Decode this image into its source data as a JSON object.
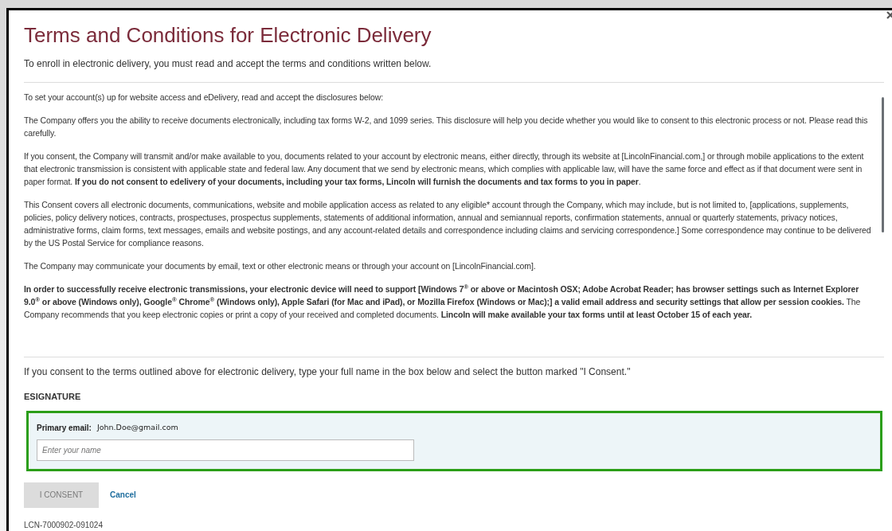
{
  "dialog": {
    "title": "Terms and Conditions for Electronic Delivery",
    "subtitle": "To enroll in electronic delivery, you must read and accept the terms and conditions written below."
  },
  "disclosure": {
    "paragraphs": [
      "To set your account(s) up for website access and eDelivery, read and accept the disclosures below:",
      "The Company offers you the ability to receive documents electronically, including tax forms W-2, and 1099 series. This disclosure will help you decide whether you would like to consent to this electronic process or not. Please read this carefully.",
      "If you consent, the Company will transmit and/or make available to you, documents related to your account by electronic means, either directly, through its website at [LincolnFinancial.com,] or through mobile applications to the extent that electronic transmission is consistent with applicable state and federal law. Any document that we send by electronic means, which complies with applicable law, will have the same force and effect as if that document were sent in paper format. **If you do not consent to edelivery of your documents, including your tax forms, Lincoln will furnish the documents and tax forms to you in paper**.",
      "This Consent covers all electronic documents, communications, website and mobile application access as related to any eligible* account through the Company, which may include, but is not limited to, [applications, supplements, policies, policy delivery notices, contracts, prospectuses, prospectus supplements, statements of additional information, annual and semiannual reports, confirmation statements, annual or quarterly statements, privacy notices, administrative forms, claim forms, text messages, emails and website postings, and any account-related details and correspondence including claims and servicing correspondence.] Some correspondence may continue to be delivered by the US Postal Service for compliance reasons.",
      "The Company may communicate your documents by email, text or other electronic means or through your account on [LincolnFinancial.com].",
      "**In order to successfully receive electronic transmissions, your electronic device will need to support [Windows 7$^{®}$ or above or Macintosh OSX; Adobe Acrobat Reader; has browser settings such as Internet Explorer 9.0$^{®}$ or above (Windows only), Google$^{®}$ Chrome$^{®}$ (Windows only), Apple Safari (for Mac and iPad), or Mozilla Firefox (Windows or Mac);] a valid email address and security settings that allow per session cookies.** The Company recommends that you keep electronic copies or print a copy of your received and completed documents. **Lincoln will make available your tax forms until at least October 15 of each year.**"
    ]
  },
  "consent": {
    "instruction": "If you consent to the terms outlined above for electronic delivery, type your full name in the box below and select the button marked \"I Consent.\"",
    "heading": "ESIGNATURE",
    "email_label": "Primary email:",
    "email": "John.Doe@gmail.com",
    "name_field": {
      "placeholder": "Enter your name"
    },
    "consent_button": {
      "label": "I CONSENT",
      "disabled": true
    },
    "cancel_link": "Cancel"
  },
  "footer_code": "LCN-7000902-091024"
}
